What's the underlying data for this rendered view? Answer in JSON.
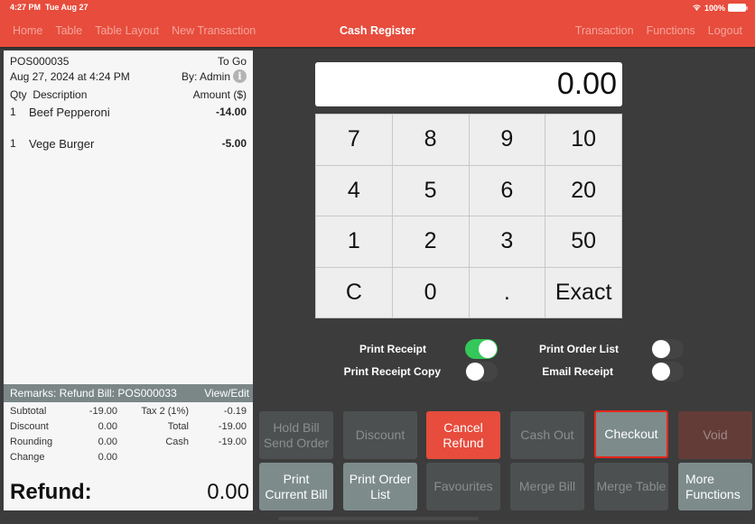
{
  "status_bar": {
    "time": "4:27 PM",
    "date": "Tue Aug 27",
    "battery": "100%"
  },
  "header": {
    "title": "Cash Register",
    "nav_left": [
      "Home",
      "Table",
      "Table Layout",
      "New Transaction"
    ],
    "nav_right": [
      "Transaction",
      "Functions",
      "Logout"
    ]
  },
  "receipt": {
    "number": "POS000035",
    "order_type": "To Go",
    "datetime": "Aug 27, 2024 at 4:24 PM",
    "by": "By: Admin",
    "columns": {
      "qty": "Qty",
      "description": "Description",
      "amount": "Amount ($)"
    },
    "items": [
      {
        "qty": "1",
        "description": "Beef Pepperoni",
        "amount": "-14.00"
      },
      {
        "qty": "1",
        "description": "Vege Burger",
        "amount": "-5.00"
      }
    ],
    "remarks": "Remarks: Refund Bill: POS000033",
    "view_edit": "View/Edit",
    "totals_left": [
      {
        "label": "Subtotal",
        "value": "-19.00"
      },
      {
        "label": "Discount",
        "value": "0.00"
      },
      {
        "label": "Rounding",
        "value": "0.00"
      },
      {
        "label": "Change",
        "value": "0.00"
      }
    ],
    "totals_right": [
      {
        "label": "Tax 2 (1%)",
        "value": "-0.19"
      },
      {
        "label": "Total",
        "value": "-19.00"
      },
      {
        "label": "Cash",
        "value": "-19.00"
      }
    ],
    "refund_label": "Refund:",
    "refund_value": "0.00"
  },
  "keypad": {
    "display": "0.00",
    "keys": [
      "7",
      "8",
      "9",
      "10",
      "4",
      "5",
      "6",
      "20",
      "1",
      "2",
      "3",
      "50",
      "C",
      "0",
      ".",
      "Exact"
    ]
  },
  "toggles": [
    {
      "label": "Print Receipt",
      "on": true
    },
    {
      "label": "Print Receipt Copy",
      "on": false
    },
    {
      "label": "Print Order List",
      "on": false
    },
    {
      "label": "Email Receipt",
      "on": false
    }
  ],
  "buttons": [
    {
      "label": "Hold Bill\nSend Order",
      "style": "dim"
    },
    {
      "label": "Discount",
      "style": "dim"
    },
    {
      "label": "Cancel\nRefund",
      "style": "red"
    },
    {
      "label": "Cash Out",
      "style": "dim"
    },
    {
      "label": "Checkout",
      "style": "grey"
    },
    {
      "label": "Void",
      "style": "void"
    },
    {
      "label": "Print\nCurrent Bill",
      "style": "grey"
    },
    {
      "label": "Print Order\nList",
      "style": "grey"
    },
    {
      "label": "Favourites",
      "style": "dim"
    },
    {
      "label": "Merge Bill",
      "style": "dim"
    },
    {
      "label": "Merge Table",
      "style": "dim"
    },
    {
      "label": "More\nFunctions",
      "style": "grey"
    }
  ],
  "colors": {
    "brand": "#e74c3c",
    "toggle_on": "#34c759",
    "checkout_highlight": "#e8271c"
  }
}
